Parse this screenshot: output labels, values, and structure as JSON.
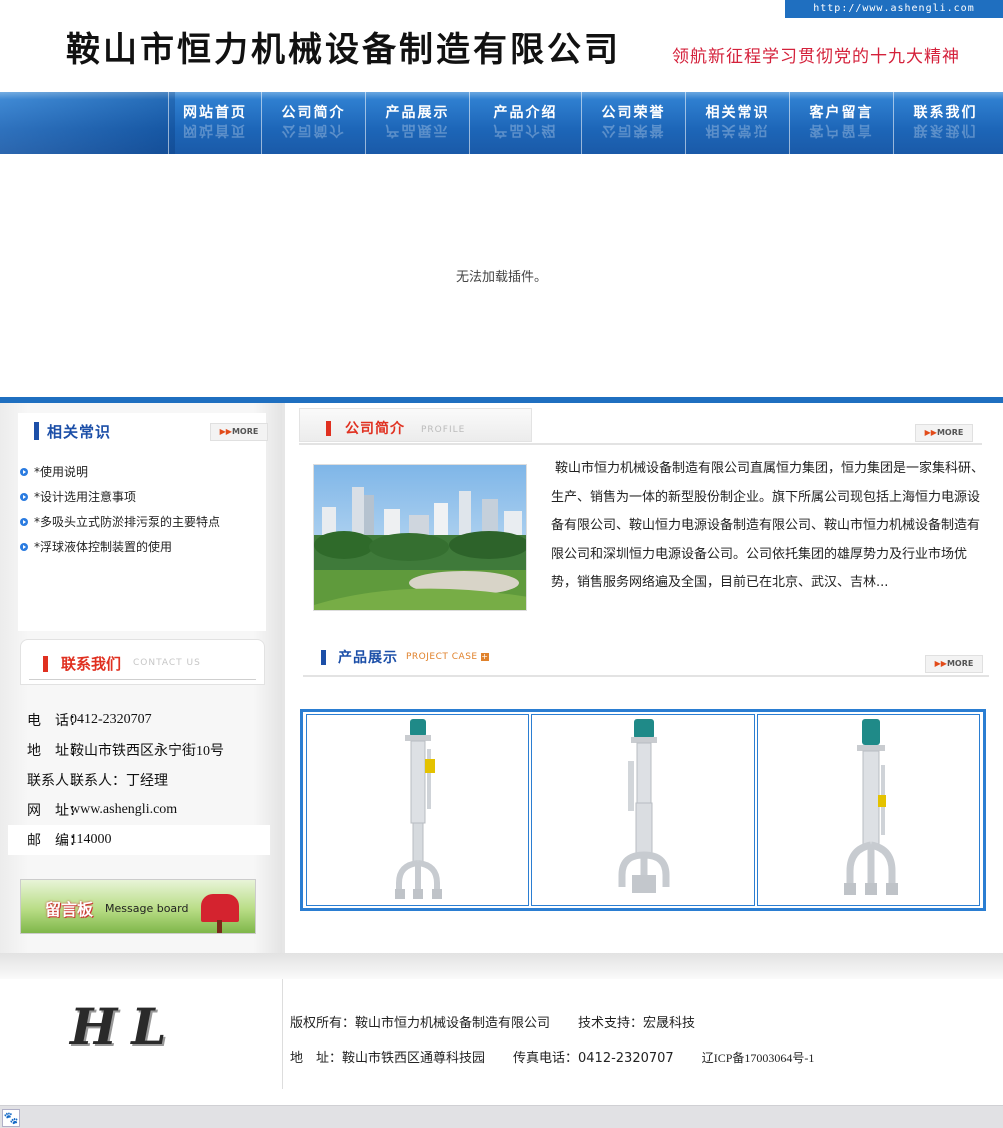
{
  "header": {
    "url": "http://www.ashengli.com",
    "title": "鞍山市恒力机械设备制造有限公司",
    "slogan": "领航新征程学习贯彻党的十九大精神"
  },
  "nav": {
    "items": [
      {
        "label": "网站首页"
      },
      {
        "label": "公司简介"
      },
      {
        "label": "产品展示"
      },
      {
        "label": "产品介绍"
      },
      {
        "label": "公司荣誉"
      },
      {
        "label": "相关常识"
      },
      {
        "label": "客户留言"
      },
      {
        "label": "联系我们"
      }
    ]
  },
  "banner": {
    "plugin_message": "无法加载插件。"
  },
  "more_label": "MORE",
  "tips": {
    "title": "相关常识",
    "items": [
      {
        "label": "*使用说明"
      },
      {
        "label": "*设计选用注意事项"
      },
      {
        "label": "*多吸头立式防淤排污泵的主要特点"
      },
      {
        "label": "*浮球液体控制装置的使用"
      }
    ]
  },
  "contact": {
    "title": "联系我们",
    "subtitle": "CONTACT US",
    "rows": [
      {
        "key": "电　话：",
        "value": "0412-2320707"
      },
      {
        "key": "地　址：",
        "value": "鞍山市铁西区永宁街10号"
      },
      {
        "key": "联系人：",
        "value": "联系人：丁经理"
      },
      {
        "key": "网　址：",
        "value": "www.ashengli.com"
      },
      {
        "key": "邮　编：",
        "value": "114000"
      }
    ]
  },
  "message_board": {
    "title": "留言板",
    "subtitle": "Message board"
  },
  "about": {
    "title": "公司简介",
    "subtitle": "PROFILE",
    "text": "鞍山市恒力机械设备制造有限公司直属恒力集团，恒力集团是一家集科研、生产、销售为一体的新型股份制企业。旗下所属公司现包括上海恒力电源设备有限公司、鞍山恒力电源设备制造有限公司、鞍山市恒力机械设备制造有限公司和深圳恒力电源设备公司。公司依托集团的雄厚势力及行业市场优势，销售服务网络遍及全国，目前已在北京、武汉、吉林..."
  },
  "products": {
    "title": "产品展示",
    "subtitle": "PROJECT CASE"
  },
  "footer": {
    "logo": "HL",
    "copyright": "版权所有：鞍山市恒力机械设备制造有限公司",
    "tech_support": "技术支持：宏晟科技",
    "address": "地　址：鞍山市铁西区通尊科技园",
    "fax": "传真电话：0412-2320707",
    "icp": "辽ICP备17003064号-1"
  },
  "colors": {
    "nav_blue": "#1d66b8",
    "accent_red": "#e03020",
    "heading_blue": "#1c4fa8",
    "slogan_red": "#d4213b"
  }
}
